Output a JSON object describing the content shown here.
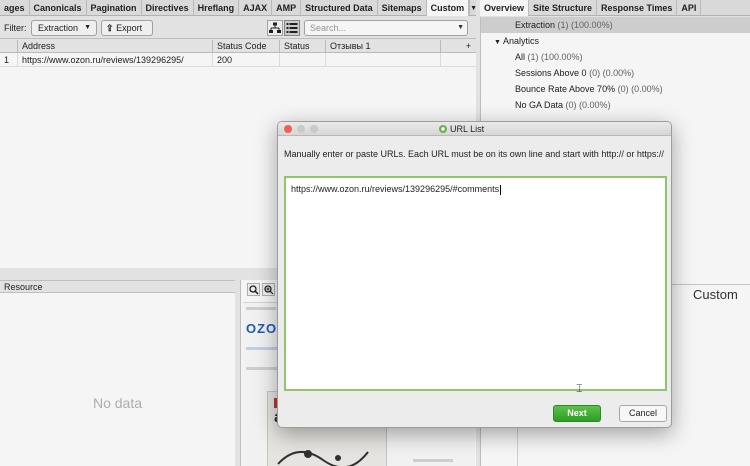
{
  "tabs": [
    "ages",
    "Canonicals",
    "Pagination",
    "Directives",
    "Hreflang",
    "AJAX",
    "AMP",
    "Structured Data",
    "Sitemaps",
    "Custom"
  ],
  "active_tab": "Custom",
  "filter": {
    "label": "Filter:",
    "value": "Extraction",
    "export_label": "Export",
    "search_placeholder": "Search..."
  },
  "table": {
    "columns": [
      "",
      "Address",
      "Status Code",
      "Status",
      "Отзывы 1"
    ],
    "rows": [
      {
        "index": "1",
        "address": "https://www.ozon.ru/reviews/139296295/",
        "status_code": "200",
        "status": "",
        "otzyvy": ""
      }
    ],
    "add_column": "+"
  },
  "resource": {
    "title": "Resource",
    "empty_text": "No data"
  },
  "right_tabs": [
    "Overview",
    "Site Structure",
    "Response Times",
    "API"
  ],
  "overview": {
    "extraction": {
      "label": "Extraction",
      "count": "(1) (100.00%)"
    },
    "analytics_label": "Analytics",
    "items": [
      {
        "label": "All",
        "count": "(1) (100.00%)"
      },
      {
        "label": "Sessions Above 0",
        "count": "(0) (0.00%)"
      },
      {
        "label": "Bounce Rate Above 70%",
        "count": "(0) (0.00%)"
      },
      {
        "label": "No GA Data",
        "count": "(0) (0.00%)"
      }
    ]
  },
  "custom_chart_label": "Custom",
  "modal": {
    "title": "URL List",
    "description": "Manually enter or paste URLs. Each URL must be on its own line and start with http:// or https://",
    "url_value": "https://www.ozon.ru/reviews/139296295/#comments",
    "next_label": "Next",
    "cancel_label": "Cancel"
  },
  "colors": {
    "accent_green": "#3aa52f",
    "field_border": "#8fc66a",
    "close_red": "#f05f56"
  }
}
